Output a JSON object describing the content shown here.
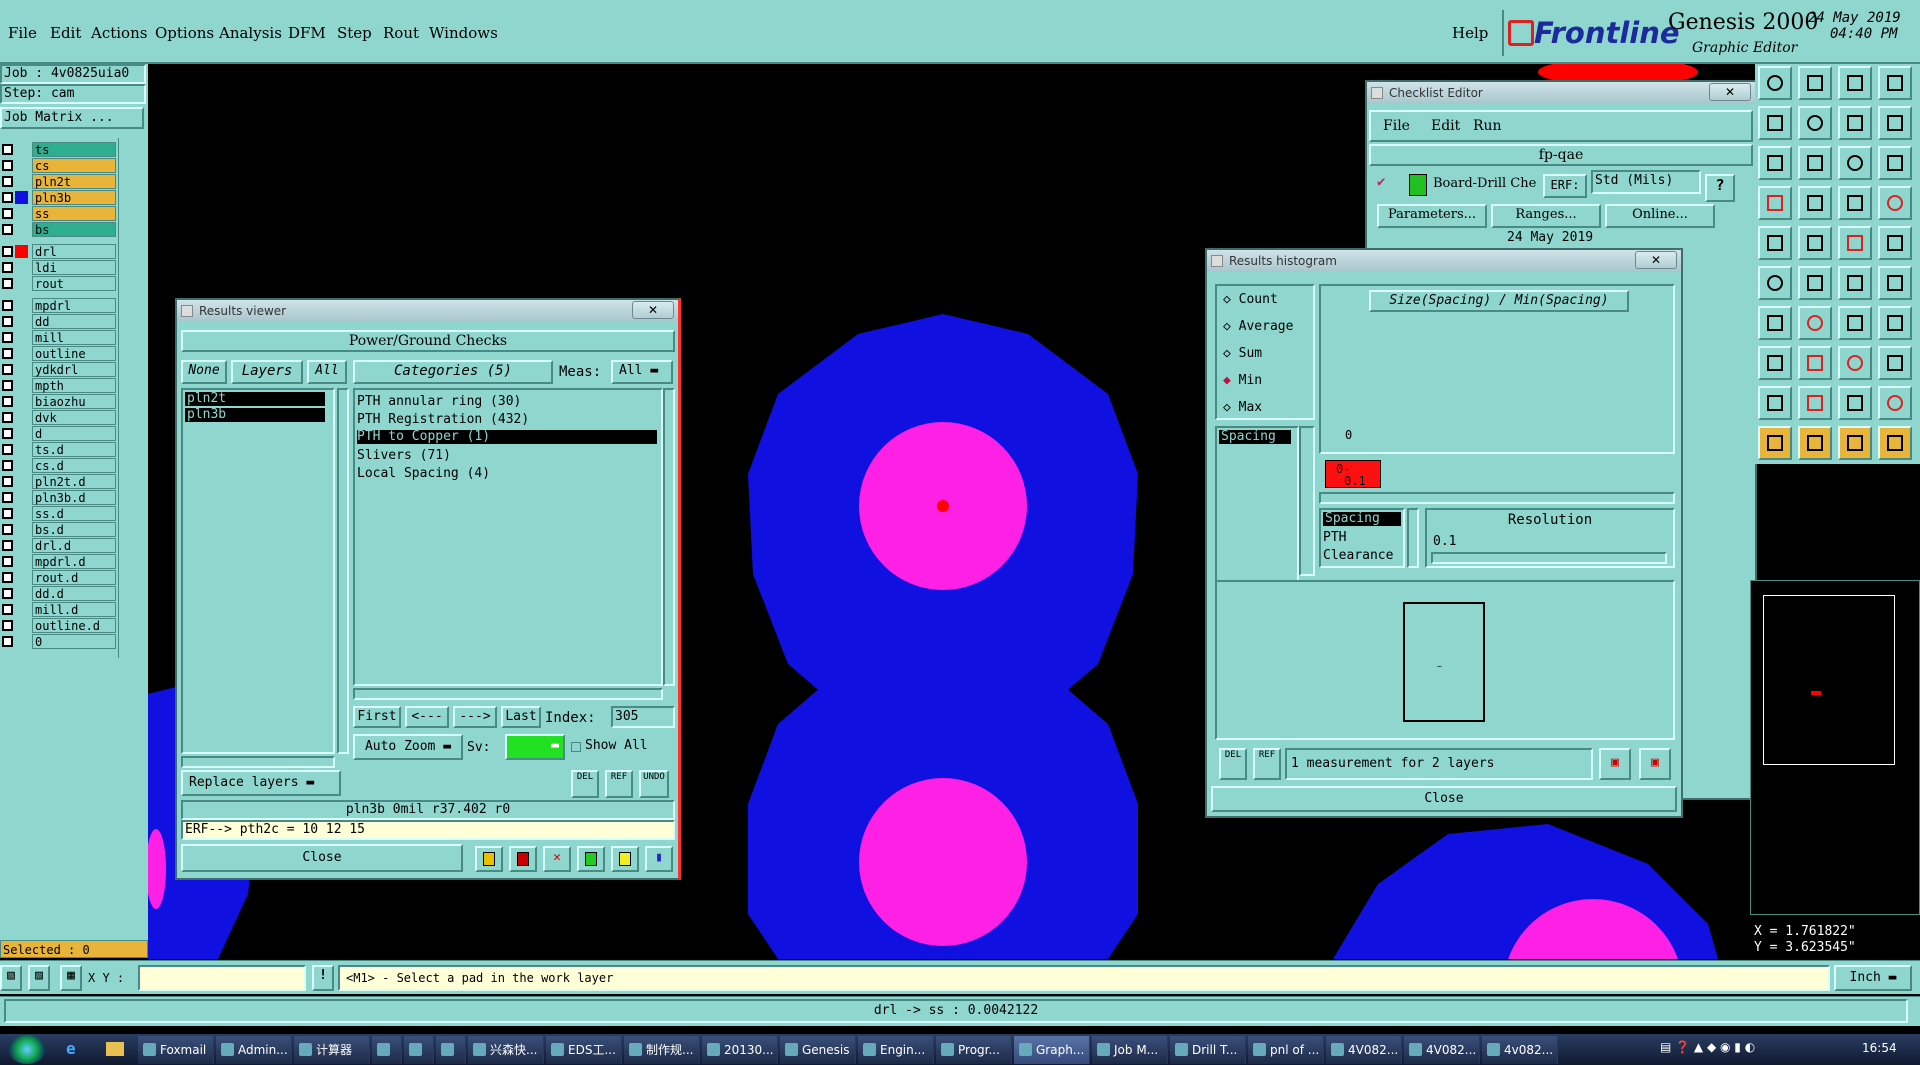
{
  "menubar": {
    "items": [
      "File",
      "Edit",
      "Actions",
      "Options",
      "Analysis",
      "DFM",
      "Step",
      "Rout",
      "Windows"
    ],
    "help": "Help",
    "brand": "Frontline",
    "product": "Genesis 2000",
    "subtitle": "Graphic Editor",
    "date": "24 May 2019",
    "time": "04:40 PM"
  },
  "left": {
    "job": "Job : 4v0825uia0",
    "step": "Step: cam",
    "job_matrix": "Job Matrix ...",
    "selected": "Selected : 0",
    "layers": [
      {
        "name": "ts",
        "color": "#2fae8f",
        "sw": ""
      },
      {
        "name": "cs",
        "color": "#e8b43a",
        "sw": ""
      },
      {
        "name": "pln2t",
        "color": "#e8b43a",
        "sw": ""
      },
      {
        "name": "pln3b",
        "color": "#e8b43a",
        "sw": "#1010e0",
        "sel": true
      },
      {
        "name": "ss",
        "color": "#e8b43a",
        "sw": ""
      },
      {
        "name": "bs",
        "color": "#2fae8f",
        "sw": ""
      },
      {
        "name": "drl",
        "color": "#8fd6cf",
        "sw": "#ff0000"
      },
      {
        "name": "ldi",
        "color": "#8fd6cf",
        "sw": ""
      },
      {
        "name": "rout",
        "color": "#8fd6cf",
        "sw": ""
      },
      {
        "name": "mpdrl",
        "color": "#8fd6cf",
        "sw": ""
      },
      {
        "name": "dd",
        "color": "#8fd6cf",
        "sw": ""
      },
      {
        "name": "mill",
        "color": "#8fd6cf",
        "sw": ""
      },
      {
        "name": "outline",
        "color": "#8fd6cf",
        "sw": ""
      },
      {
        "name": "ydkdrl",
        "color": "#8fd6cf",
        "sw": ""
      },
      {
        "name": "mpth",
        "color": "#8fd6cf",
        "sw": ""
      },
      {
        "name": "biaozhu",
        "color": "#8fd6cf",
        "sw": ""
      },
      {
        "name": "dvk",
        "color": "#8fd6cf",
        "sw": ""
      },
      {
        "name": "d",
        "color": "#8fd6cf",
        "sw": ""
      },
      {
        "name": "ts.d",
        "color": "#8fd6cf",
        "sw": ""
      },
      {
        "name": "cs.d",
        "color": "#8fd6cf",
        "sw": ""
      },
      {
        "name": "pln2t.d",
        "color": "#8fd6cf",
        "sw": ""
      },
      {
        "name": "pln3b.d",
        "color": "#8fd6cf",
        "sw": ""
      },
      {
        "name": "ss.d",
        "color": "#8fd6cf",
        "sw": ""
      },
      {
        "name": "bs.d",
        "color": "#8fd6cf",
        "sw": ""
      },
      {
        "name": "drl.d",
        "color": "#8fd6cf",
        "sw": ""
      },
      {
        "name": "mpdrl.d",
        "color": "#8fd6cf",
        "sw": ""
      },
      {
        "name": "rout.d",
        "color": "#8fd6cf",
        "sw": ""
      },
      {
        "name": "dd.d",
        "color": "#8fd6cf",
        "sw": ""
      },
      {
        "name": "mill.d",
        "color": "#8fd6cf",
        "sw": ""
      },
      {
        "name": "outline.d",
        "color": "#8fd6cf",
        "sw": ""
      },
      {
        "name": "0",
        "color": "#8fd6cf",
        "sw": ""
      }
    ]
  },
  "results_viewer": {
    "title": "Results viewer",
    "heading": "Power/Ground Checks",
    "none": "None",
    "layers_label": "Layers",
    "all": "All",
    "categories": "Categories (5)",
    "meas_label": "Meas:",
    "meas_value": "All",
    "layer_list": [
      "pln2t",
      "pln3b"
    ],
    "category_list": [
      "PTH annular ring (30)",
      "PTH Registration (432)",
      "PTH to Copper (1)",
      "Slivers (71)",
      "Local Spacing (4)"
    ],
    "first": "First",
    "prev": "<---",
    "next": "--->",
    "last": "Last",
    "index_label": "Index:",
    "index_value": "305",
    "auto_zoom": "Auto Zoom",
    "sv": "Sv:",
    "show_all": "Show All",
    "replace_layers": "Replace layers",
    "info": "pln3b 0mil  r37.402  r0",
    "erf": "ERF--> pth2c = 10 12 15",
    "close": "Close",
    "del": "DEL",
    "ref": "REF",
    "undo": "UNDO"
  },
  "checklist": {
    "title": "Checklist Editor",
    "menu": [
      "File",
      "Edit",
      "Run"
    ],
    "name": "fp-qae",
    "action": "Board-Drill Che",
    "erf": "ERF:",
    "std": "Std (Mils)",
    "parameters": "Parameters...",
    "ranges": "Ranges...",
    "online": "Online...",
    "date": "24 May 2019"
  },
  "histogram": {
    "title": "Results histogram",
    "radios": [
      "Count",
      "Average",
      "Sum",
      "Min",
      "Max"
    ],
    "selected_radio": "Min",
    "chart_title": "Size(Spacing) / Min(Spacing)",
    "zero": "0",
    "bin": "0-",
    "bin2": "0.1",
    "left_list": [
      "Spacing"
    ],
    "list2": [
      "Spacing",
      "PTH",
      "Clearance"
    ],
    "resolution": "Resolution",
    "resolution_value": "0.1",
    "status": "1 measurement for 2 layers",
    "close": "Close",
    "del": "DEL",
    "ref": "REF"
  },
  "right_panel": {
    "x": "X = 1.761822\"",
    "y": "Y = 3.623545\""
  },
  "bottom": {
    "xy": "X Y :",
    "prompt": "<M1> - Select a pad in the work layer",
    "units": "Inch",
    "measure": "drl -> ss : 0.0042122"
  },
  "taskbar": {
    "items": [
      "Foxmail",
      "Admin...",
      "计算器",
      "",
      "",
      "",
      "兴森快...",
      "EDS工...",
      "制作规...",
      "20130...",
      "Genesis",
      "Engin...",
      "Progr...",
      "Graph...",
      "Job M...",
      "Drill T...",
      "pnl of ...",
      "4V082...",
      "4V082...",
      "4v082..."
    ],
    "clock": "16:54"
  },
  "colors": {
    "panel": "#8fd6cf",
    "pad_blue": "#1010e0",
    "pad_magenta": "#ff20e6",
    "red": "#ff0000"
  }
}
